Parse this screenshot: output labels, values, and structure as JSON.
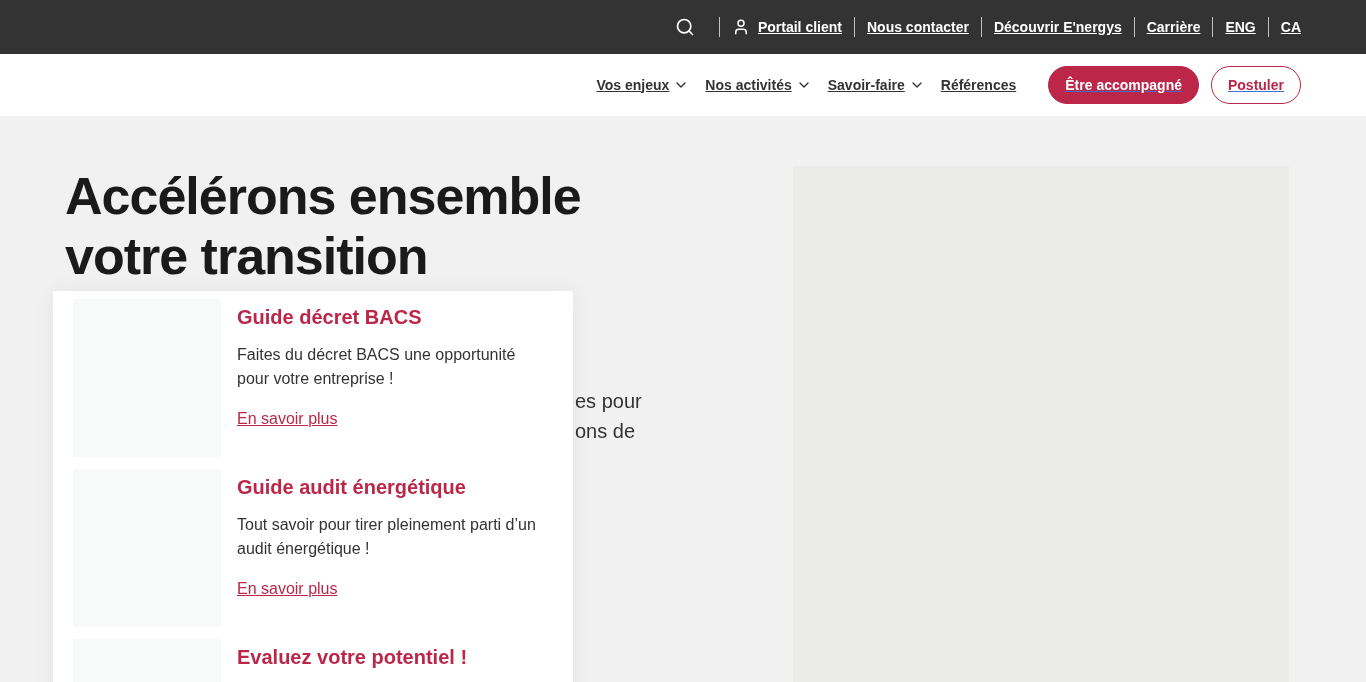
{
  "top_bar": {
    "links": [
      {
        "label": "Portail client",
        "kind": "account"
      },
      {
        "label": "Nous contacter"
      },
      {
        "label": "Découvrir E'nergys"
      },
      {
        "label": "Carrière"
      },
      {
        "label": "ENG"
      },
      {
        "label": "CA"
      }
    ]
  },
  "nav": {
    "items": [
      {
        "label": "Vos enjeux",
        "dropdown": true
      },
      {
        "label": "Nos activités",
        "dropdown": true
      },
      {
        "label": "Savoir-faire",
        "dropdown": true
      },
      {
        "label": "Références",
        "dropdown": false
      }
    ],
    "buttons": [
      {
        "label": "Être accompagné",
        "kind": "primary"
      },
      {
        "label": "Postuler",
        "kind": "outline"
      }
    ]
  },
  "hero": {
    "title_lines": [
      "Accélérons ensemble",
      "votre transition"
    ],
    "text_fragments": [
      "es pour",
      "ons de"
    ]
  },
  "guides": [
    {
      "title": "Guide décret BACS",
      "text": "Faites du décret BACS une opportunité pour votre entreprise !",
      "link": "En savoir plus"
    },
    {
      "title": "Guide audit énergétique",
      "text": "Tout savoir pour tirer pleinement parti d’un audit énergétique !",
      "link": "En savoir plus"
    },
    {
      "title": "Evaluez votre potentiel !"
    }
  ]
}
